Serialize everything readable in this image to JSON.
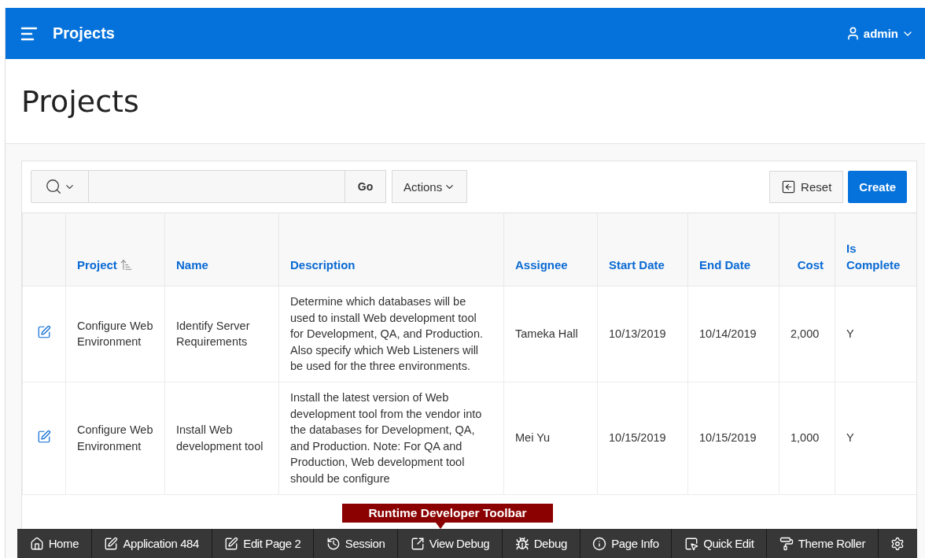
{
  "header": {
    "title": "Projects",
    "user": "admin"
  },
  "page_title": "Projects",
  "report_toolbar": {
    "go": "Go",
    "actions": "Actions",
    "reset": "Reset",
    "create": "Create"
  },
  "table": {
    "columns": [
      {
        "label": "Project",
        "sorted": true
      },
      {
        "label": "Name",
        "sorted": false
      },
      {
        "label": "Description",
        "sorted": false
      },
      {
        "label": "Assignee",
        "sorted": false
      },
      {
        "label": "Start Date",
        "sorted": false
      },
      {
        "label": "End Date",
        "sorted": false
      },
      {
        "label": "Cost",
        "sorted": false
      },
      {
        "label": "Is Complete",
        "sorted": false
      }
    ],
    "rows": [
      {
        "cells": [
          "Configure Web Environment",
          "Identify Server Requirements",
          "Determine which databases will be used to install Web development tool for Development, QA, and Production. Also specify which Web Listeners will be used for the three environments.",
          "Tameka Hall",
          "10/13/2019",
          "10/14/2019",
          "2,000",
          "Y"
        ]
      },
      {
        "cells": [
          "Configure Web Environment",
          "Install Web development tool",
          "Install the latest version of Web development tool from the vendor into the databases for Development, QA, and Production. Note: For QA and Production, Web development tool should be configure",
          "Mei Yu",
          "10/15/2019",
          "10/15/2019",
          "1,000",
          "Y"
        ]
      }
    ]
  },
  "callout": "Runtime Developer Toolbar",
  "dev_toolbar": [
    {
      "kind": "home",
      "label": "Home"
    },
    {
      "kind": "application",
      "label": "Application 484"
    },
    {
      "kind": "edit_page",
      "label": "Edit Page 2"
    },
    {
      "kind": "session",
      "label": "Session"
    },
    {
      "kind": "view_debug",
      "label": "View Debug"
    },
    {
      "kind": "debug",
      "label": "Debug"
    },
    {
      "kind": "page_info",
      "label": "Page Info"
    },
    {
      "kind": "quick_edit",
      "label": "Quick Edit"
    },
    {
      "kind": "theme_roller",
      "label": "Theme Roller"
    },
    {
      "kind": "settings"
    }
  ]
}
